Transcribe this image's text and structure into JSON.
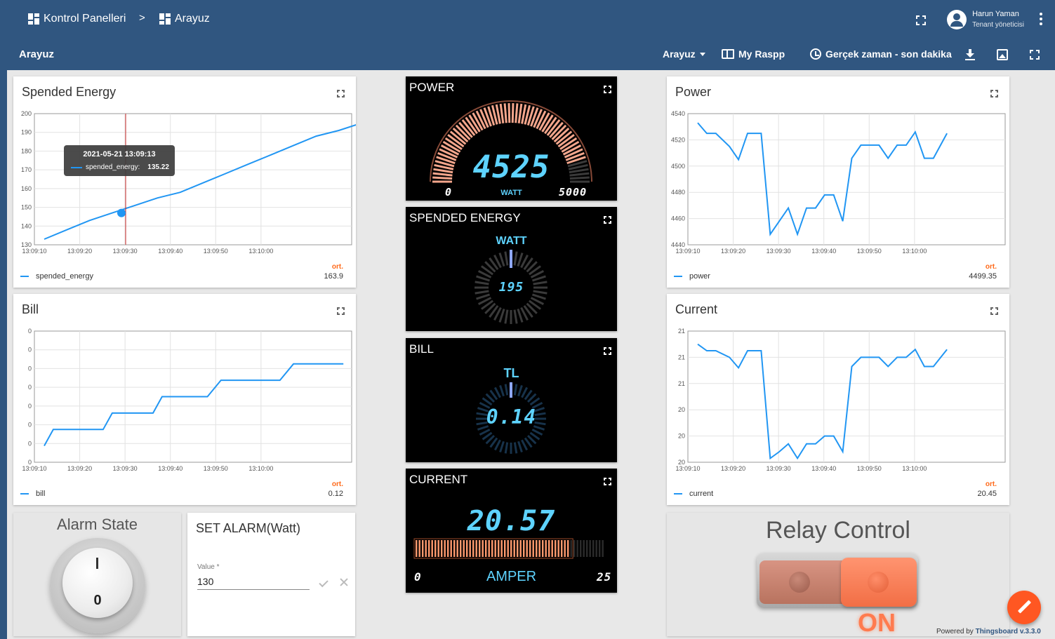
{
  "header": {
    "breadcrumb": [
      {
        "label": "Kontrol Panelleri",
        "icon": "dashboards-icon"
      },
      {
        "label": "Arayuz",
        "icon": "dashboard-icon"
      }
    ],
    "separator": ">",
    "user": {
      "name": "Harun Yaman",
      "role": "Tenant yöneticisi"
    }
  },
  "toolbar": {
    "title": "Arayuz",
    "state_select": "Arayuz",
    "entity_alias": "My Raspp",
    "timewindow": "Gerçek zaman - son dakika"
  },
  "widgets": {
    "spended_energy": {
      "title": "Spended Energy",
      "legend": "spended_energy",
      "avg_label": "ort.",
      "avg": "163.9",
      "tooltip": {
        "time": "2021-05-21 13:09:13",
        "label": "spended_energy:",
        "value": "135.22"
      }
    },
    "bill": {
      "title": "Bill",
      "legend": "bill",
      "avg_label": "ort.",
      "avg": "0.12"
    },
    "power": {
      "title": "Power",
      "legend": "power",
      "avg_label": "ort.",
      "avg": "4499.35"
    },
    "current": {
      "title": "Current",
      "legend": "current",
      "avg_label": "ort.",
      "avg": "20.45"
    },
    "power_gauge": {
      "title": "POWER",
      "value": "4525",
      "unit": "WATT",
      "min": "0",
      "max": "5000",
      "level": 0.905
    },
    "energy_gauge": {
      "title": "SPENDED ENERGY",
      "unit": "WATT",
      "value": "195"
    },
    "bill_gauge": {
      "title": "BILL",
      "unit": "TL",
      "value": "0.14"
    },
    "current_gauge": {
      "title": "CURRENT",
      "value": "20.57",
      "unit": "AMPER",
      "min": "0",
      "max": "25",
      "level": 0.823
    },
    "alarm_state": {
      "title": "Alarm State",
      "on_label": "I",
      "off_label": "0"
    },
    "set_alarm": {
      "title": "SET ALARM(Watt)",
      "field_label": "Value *",
      "field_value": "130"
    },
    "relay": {
      "title": "Relay Control",
      "state": "ON"
    }
  },
  "footer": {
    "powered_prefix": "Powered by",
    "powered_link": "Thingsboard v.3.3.0"
  },
  "colors": {
    "primary": "#305680",
    "series": "#2196f3",
    "accent": "#ff5722",
    "lcd": "#5ed3ff"
  },
  "chart_data": [
    {
      "type": "line",
      "title": "Spended Energy",
      "x": [
        "13:09:10",
        "13:09:15",
        "13:09:20",
        "13:09:25",
        "13:09:30",
        "13:09:35",
        "13:09:40",
        "13:09:45",
        "13:09:50",
        "13:09:55",
        "13:10:00",
        "13:10:05",
        "13:10:10"
      ],
      "x_ticks": [
        "13:09:10",
        "13:09:20",
        "13:09:30",
        "13:09:40",
        "13:09:50",
        "13:10:00"
      ],
      "ylim": [
        130,
        200
      ],
      "y_ticks": [
        "130",
        "140",
        "150",
        "160",
        "170",
        "180",
        "190",
        "200"
      ],
      "series": [
        {
          "name": "spended_energy",
          "values": [
            133,
            138,
            143,
            147,
            151,
            155,
            158,
            163,
            168,
            173,
            178,
            183,
            188,
            191,
            195
          ]
        }
      ],
      "x_points": [
        0,
        5,
        10,
        15,
        20,
        25,
        30,
        35,
        40,
        45,
        50,
        55,
        60,
        65,
        70
      ]
    },
    {
      "type": "line",
      "title": "Bill",
      "x_ticks": [
        "13:09:10",
        "13:09:20",
        "13:09:30",
        "13:09:40",
        "13:09:50",
        "13:10:00"
      ],
      "y_ticks": [
        "0",
        "0",
        "0",
        "0",
        "0",
        "0",
        "0",
        "0"
      ],
      "ylim": [
        0.06,
        0.14
      ],
      "series": [
        {
          "name": "bill",
          "values": [
            0.07,
            0.08,
            0.08,
            0.08,
            0.09,
            0.09,
            0.09,
            0.1,
            0.1,
            0.1,
            0.11,
            0.11,
            0.11,
            0.12,
            0.12,
            0.12
          ]
        }
      ],
      "x_points": [
        0,
        2,
        10,
        13,
        15,
        20,
        24,
        26,
        32,
        36,
        39,
        48,
        52,
        55,
        61,
        66
      ]
    },
    {
      "type": "line",
      "title": "Power",
      "x_ticks": [
        "13:09:10",
        "13:09:20",
        "13:09:30",
        "13:09:40",
        "13:09:50",
        "13:10:00"
      ],
      "y_ticks": [
        "4440",
        "4460",
        "4480",
        "4500",
        "4520",
        "4540"
      ],
      "ylim": [
        4440,
        4540
      ],
      "series": [
        {
          "name": "power",
          "values": [
            4533,
            4525,
            4525,
            4515,
            4505,
            4525,
            4525,
            4448,
            4458,
            4468,
            4448,
            4468,
            4468,
            4478,
            4478,
            4458,
            4506,
            4516,
            4516,
            4516,
            4506,
            4516,
            4516,
            4526,
            4506,
            4506,
            4525
          ]
        }
      ],
      "x_points": [
        0,
        2,
        4,
        7,
        9,
        11,
        14,
        16,
        18,
        20,
        22,
        24,
        26,
        28,
        30,
        32,
        34,
        36,
        38,
        40,
        42,
        44,
        46,
        48,
        50,
        52,
        55
      ]
    },
    {
      "type": "line",
      "title": "Current",
      "x_ticks": [
        "13:09:10",
        "13:09:20",
        "13:09:30",
        "13:09:40",
        "13:09:50",
        "13:10:00"
      ],
      "y_ticks": [
        "20",
        "20",
        "20",
        "21",
        "21",
        "21"
      ],
      "ylim": [
        20.0,
        21.0
      ],
      "series": [
        {
          "name": "current",
          "values": [
            20.9,
            20.85,
            20.85,
            20.8,
            20.72,
            20.85,
            20.85,
            20.03,
            20.08,
            20.14,
            20.03,
            20.14,
            20.14,
            20.2,
            20.2,
            20.08,
            20.73,
            20.8,
            20.8,
            20.8,
            20.73,
            20.8,
            20.8,
            20.86,
            20.73,
            20.73,
            20.86
          ]
        }
      ],
      "x_points": [
        0,
        2,
        4,
        7,
        9,
        11,
        14,
        16,
        18,
        20,
        22,
        24,
        26,
        28,
        30,
        32,
        34,
        36,
        38,
        40,
        42,
        44,
        46,
        48,
        50,
        52,
        55
      ]
    }
  ]
}
